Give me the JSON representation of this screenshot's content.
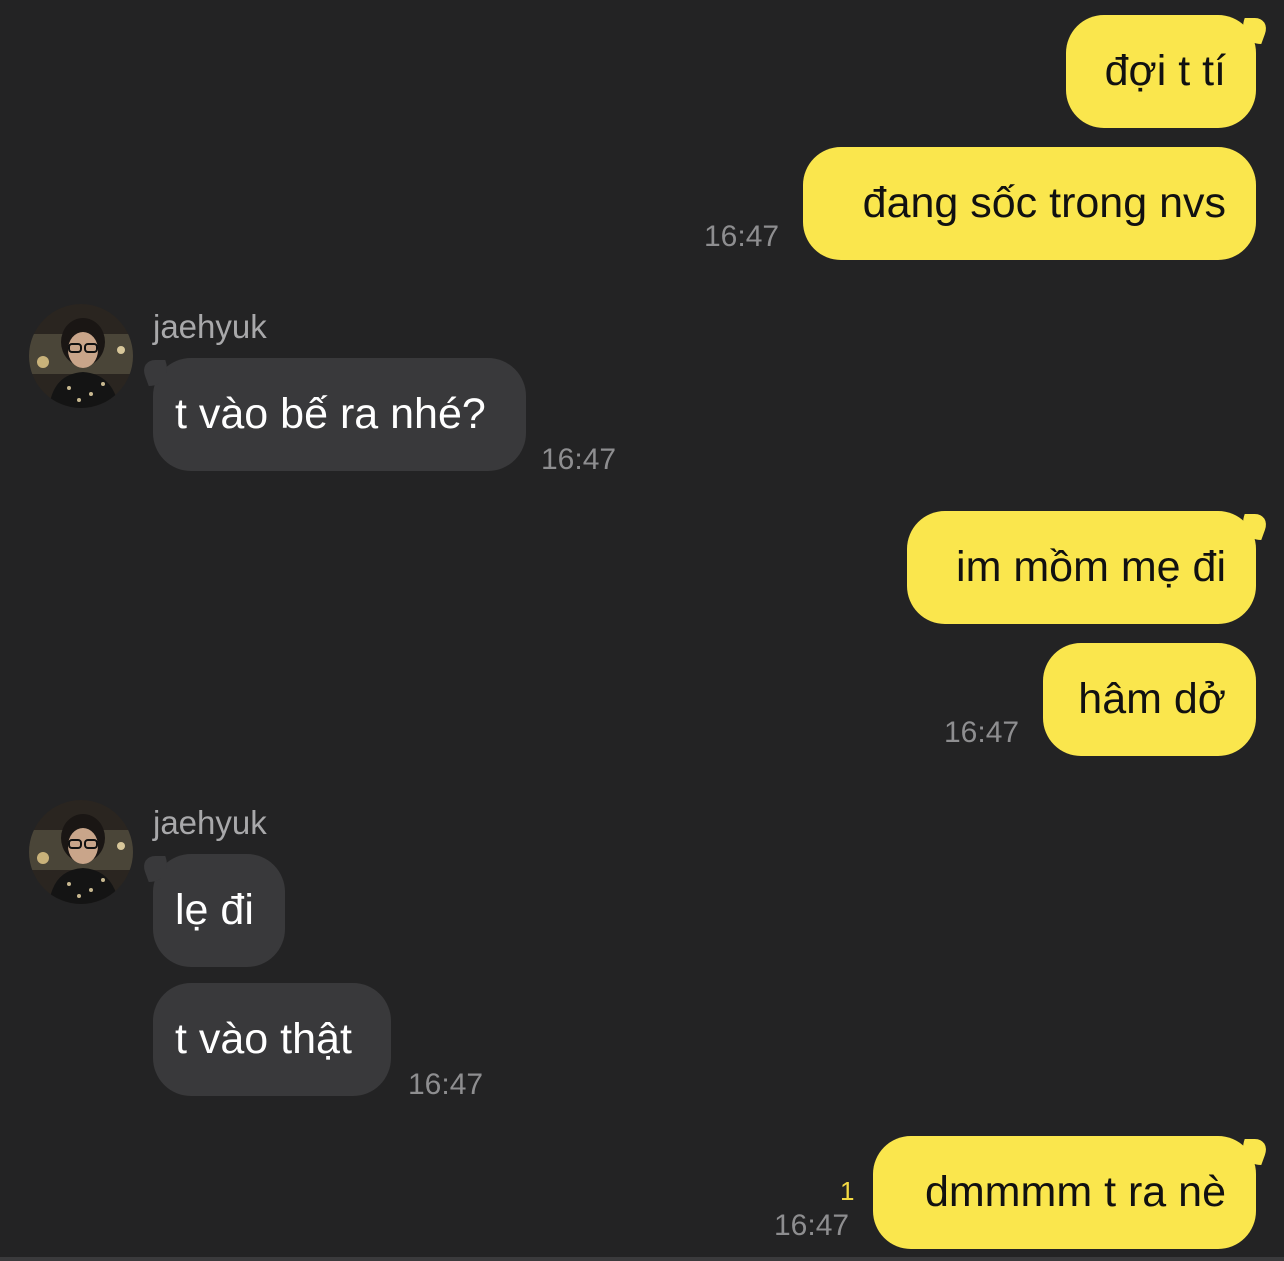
{
  "colors": {
    "background": "#232324",
    "outgoing_bubble": "#fae64d",
    "incoming_bubble": "#39393b",
    "timestamp": "#8e8e90",
    "unread": "#f3d943"
  },
  "messages": [
    {
      "direction": "out",
      "text": "đợi t tí",
      "time": ""
    },
    {
      "direction": "out",
      "text": "đang sốc trong nvs",
      "time": "16:47"
    },
    {
      "direction": "in",
      "sender": "jaehyuk",
      "text": "t vào bế ra nhé?",
      "time": "16:47"
    },
    {
      "direction": "out",
      "text": "im mồm mẹ đi",
      "time": ""
    },
    {
      "direction": "out",
      "text": "hâm dở",
      "time": "16:47"
    },
    {
      "direction": "in",
      "sender": "jaehyuk",
      "text": "lẹ đi",
      "time": ""
    },
    {
      "direction": "in",
      "text": "t vào thật",
      "time": "16:47"
    },
    {
      "direction": "out",
      "text": "dmmmm t ra nè",
      "time": "16:47",
      "unread_count": "1"
    }
  ],
  "icons": {
    "avatar": "profile-photo-avatar"
  }
}
